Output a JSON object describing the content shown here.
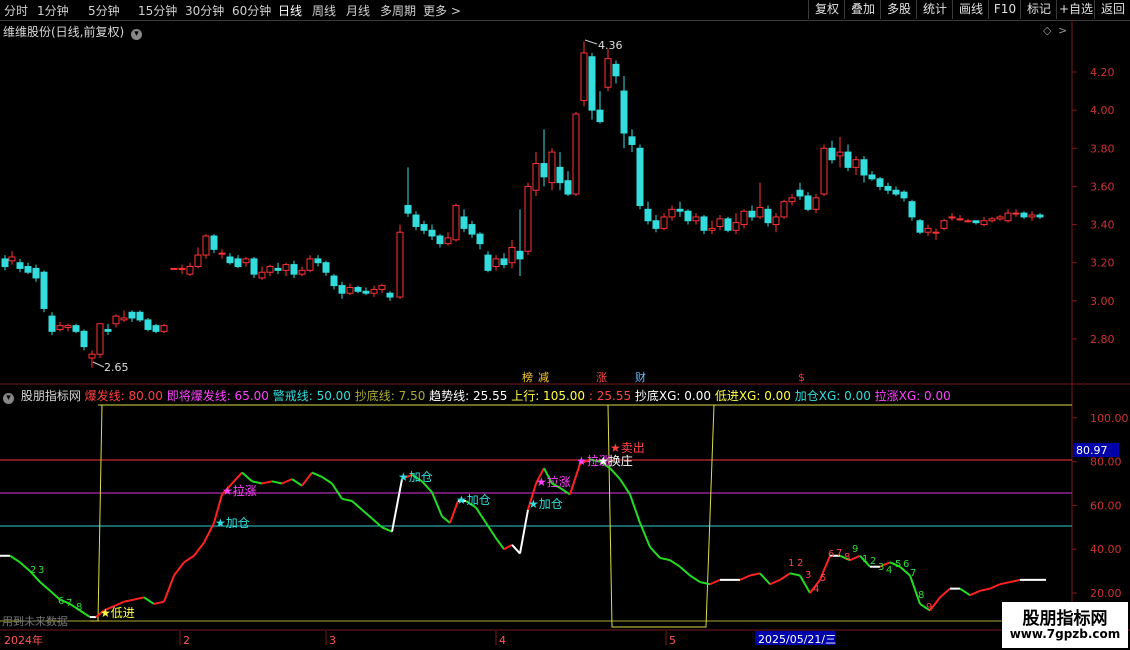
{
  "toolbar": {
    "periods": [
      "分时",
      "1分钟",
      "5分钟",
      "15分钟",
      "30分钟",
      "60分钟",
      "日线",
      "周线",
      "月线",
      "多周期",
      "更多 >"
    ],
    "active": "日线",
    "buttons": [
      "复权",
      "叠加",
      "多股",
      "统计",
      "画线",
      "F10",
      "标记",
      "+自选",
      "返回"
    ]
  },
  "stock": {
    "title": "维维股份(日线,前复权)",
    "high_label": "4.36",
    "low_label": "2.65",
    "price_ticks": [
      "4.20",
      "4.00",
      "3.80",
      "3.60",
      "3.40",
      "3.20",
      "3.00",
      "2.80"
    ],
    "event_markers": [
      {
        "label": "榜",
        "color": "#ffcc33"
      },
      {
        "label": "减",
        "color": "#ffcc33"
      },
      {
        "label": "涨",
        "color": "#ff4444"
      },
      {
        "label": "财",
        "color": "#66bbff"
      },
      {
        "label": "$",
        "color": "#ff3333"
      }
    ]
  },
  "indicator": {
    "name": "股朋指标网",
    "params": [
      {
        "text": "爆发线: 80.00",
        "color": "#ff4040"
      },
      {
        "text": "即将爆发线: 65.00",
        "color": "#ff44ff"
      },
      {
        "text": "警戒线: 50.00",
        "color": "#33dddd"
      },
      {
        "text": "抄底线: 7.50",
        "color": "#aaaa33"
      },
      {
        "text": "趋势线: 25.55",
        "color": "#ffffff"
      },
      {
        "text": "上行: 105.00",
        "color": "#ffff44"
      },
      {
        "text": ": 25.55",
        "color": "#ff4444"
      },
      {
        "text": "抄底XG: 0.00",
        "color": "#ffffff"
      },
      {
        "text": "低进XG: 0.00",
        "color": "#ffff44"
      },
      {
        "text": "加仓XG: 0.00",
        "color": "#33dddd"
      },
      {
        "text": "拉涨XG: 0.00",
        "color": "#ff44ff"
      }
    ],
    "y_ticks": [
      "100.00",
      "80.00",
      "60.00",
      "40.00",
      "20.00"
    ],
    "current_value": "80.97",
    "annotations": {
      "jiacang": "加仓",
      "lazhang": "拉涨",
      "dijin": "低进",
      "maichu": "卖出",
      "huanzhuang": "换庄",
      "digits": [
        "1",
        "2",
        "3",
        "4",
        "5",
        "6",
        "7",
        "8",
        "9"
      ]
    },
    "future_note": "用到未来数据"
  },
  "timeline": {
    "year": "2024年",
    "months": [
      "2",
      "3",
      "4",
      "5"
    ],
    "cursor_date": "2025/05/21/三"
  },
  "watermark": {
    "name": "股朋指标网",
    "url": "www.7gpzb.com"
  },
  "chart_data": {
    "type": "candlestick",
    "price_axis": [
      2.65,
      4.36
    ],
    "indicator_levels": {
      "爆发线": 80,
      "即将爆发线": 65,
      "警戒线": 50,
      "抄底线": 7.5,
      "上行": 105
    }
  }
}
